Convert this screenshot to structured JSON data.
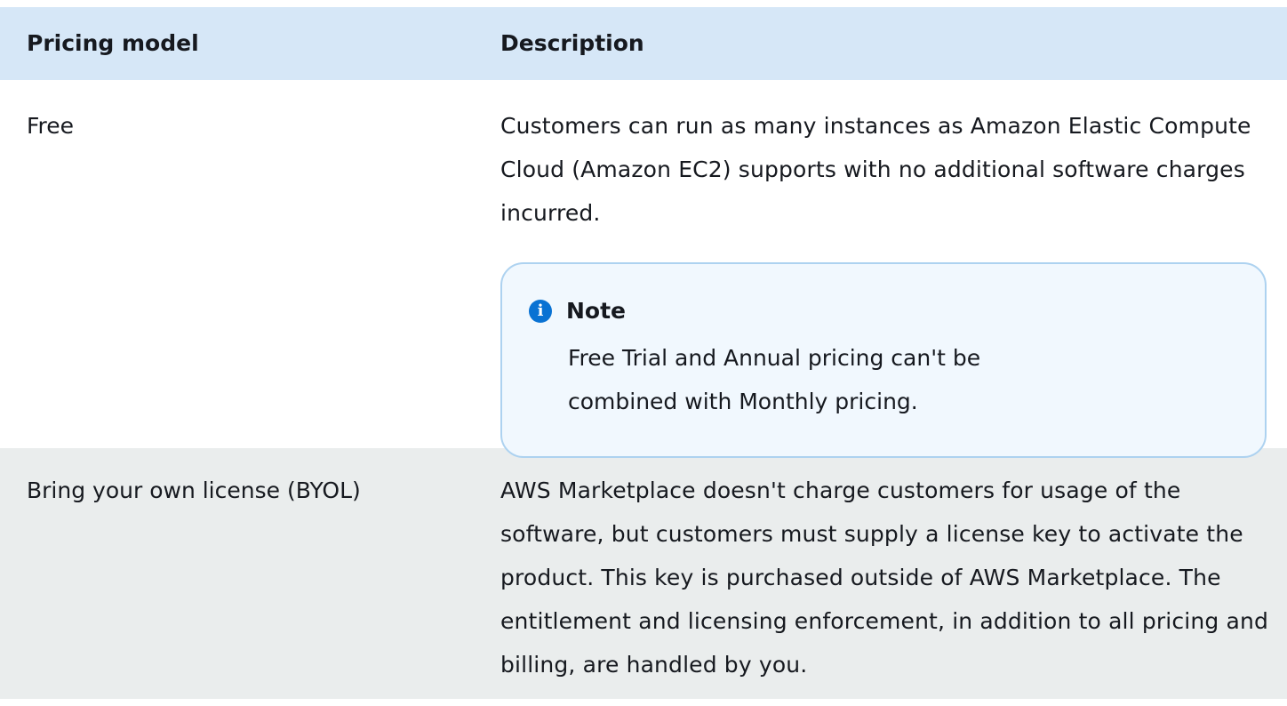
{
  "table": {
    "headers": {
      "pricing_model": "Pricing model",
      "description": "Description"
    },
    "rows": [
      {
        "pricing_model": "Free",
        "description": "Customers can run as many instances as Amazon Elastic Compute Cloud (Amazon EC2) supports with no additional software charges incurred.",
        "note": {
          "icon": "info-icon",
          "title": "Note",
          "body": "Free Trial and Annual pricing can't be combined with Monthly pricing."
        }
      },
      {
        "pricing_model": "Bring your own license (BYOL)",
        "description": "AWS Marketplace doesn't charge customers for usage of the software, but customers must supply a license key to activate the product. This key is purchased outside of AWS Marketplace. The entitlement and licensing enforcement, in addition to all pricing and billing, are handled by you."
      }
    ]
  },
  "colors": {
    "header_bg": "#d6e7f7",
    "note_bg": "#f1f8fe",
    "note_border": "#add2f0",
    "info_icon": "#0972d3",
    "alt_row_bg": "#eaeded",
    "text": "#16191f"
  }
}
